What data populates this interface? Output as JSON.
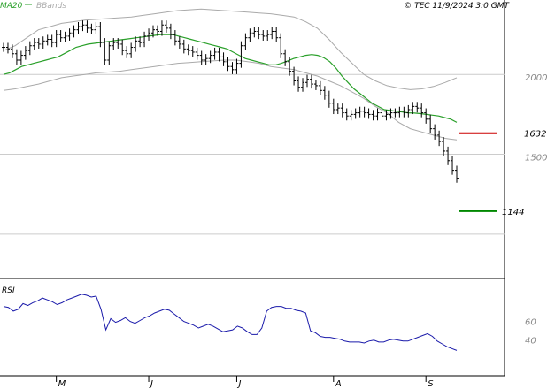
{
  "header": {
    "legend": [
      {
        "label": "MA20",
        "color": "#2aa02a"
      },
      {
        "label": "BBands",
        "color": "#aaaaaa"
      }
    ],
    "copyright": "© TEC 11/9/2024 3:0 GMT"
  },
  "colors": {
    "price": "#000000",
    "ma20": "#2aa02a",
    "bbands": "#aaaaaa",
    "rsi": "#1a1aaa",
    "resistance": "#cc0000",
    "support": "#008800",
    "grid": "#cccccc"
  },
  "chart_data": [
    {
      "type": "ohlc",
      "panel": "price",
      "ylim": [
        750,
        2400
      ],
      "yticks": [
        2000,
        1500
      ],
      "ytick_labels": [
        "2000",
        "1500"
      ],
      "levels": [
        {
          "name": "resistance",
          "value": 1632,
          "label": "1632"
        },
        {
          "name": "support",
          "value": 1144,
          "label": "1144"
        }
      ],
      "x_month_labels": [
        {
          "label": "M",
          "index": 12
        },
        {
          "label": "J",
          "index": 33
        },
        {
          "label": "J",
          "index": 53
        },
        {
          "label": "A",
          "index": 75
        },
        {
          "label": "S",
          "index": 96
        }
      ],
      "close": [
        2170,
        2160,
        2130,
        2090,
        2120,
        2150,
        2180,
        2200,
        2190,
        2210,
        2220,
        2200,
        2250,
        2230,
        2240,
        2260,
        2280,
        2300,
        2310,
        2290,
        2280,
        2300,
        2200,
        2090,
        2180,
        2200,
        2190,
        2150,
        2130,
        2170,
        2210,
        2200,
        2240,
        2260,
        2280,
        2270,
        2310,
        2290,
        2250,
        2210,
        2190,
        2160,
        2150,
        2140,
        2120,
        2090,
        2100,
        2120,
        2140,
        2110,
        2080,
        2050,
        2030,
        2070,
        2180,
        2230,
        2260,
        2270,
        2250,
        2240,
        2250,
        2270,
        2230,
        2130,
        2080,
        2020,
        1960,
        1920,
        1950,
        1970,
        1940,
        1930,
        1900,
        1870,
        1820,
        1780,
        1790,
        1760,
        1740,
        1750,
        1760,
        1770,
        1760,
        1750,
        1740,
        1760,
        1740,
        1750,
        1760,
        1760,
        1770,
        1760,
        1780,
        1800,
        1790,
        1760,
        1720,
        1660,
        1620,
        1580,
        1520,
        1460,
        1400,
        1350
      ]
    },
    {
      "type": "line",
      "panel": "price",
      "name": "MA20",
      "values": [
        2000,
        2010,
        2030,
        2050,
        2060,
        2070,
        2080,
        2090,
        2100,
        2110,
        2130,
        2150,
        2170,
        2180,
        2190,
        2195,
        2200,
        2205,
        2210,
        2215,
        2220,
        2225,
        2230,
        2235,
        2240,
        2245,
        2250,
        2250,
        2250,
        2240,
        2230,
        2220,
        2210,
        2200,
        2190,
        2180,
        2170,
        2160,
        2140,
        2120,
        2100,
        2090,
        2080,
        2070,
        2060,
        2060,
        2070,
        2085,
        2100,
        2110,
        2120,
        2125,
        2120,
        2105,
        2080,
        2040,
        1990,
        1950,
        1910,
        1880,
        1850,
        1820,
        1800,
        1780,
        1775,
        1770,
        1765,
        1760,
        1758,
        1755,
        1750,
        1745,
        1740,
        1730,
        1720,
        1700
      ]
    },
    {
      "type": "band",
      "panel": "price",
      "name": "BBands",
      "upper": [
        2150,
        2180,
        2230,
        2280,
        2300,
        2320,
        2330,
        2340,
        2345,
        2350,
        2355,
        2360,
        2370,
        2380,
        2390,
        2400,
        2405,
        2410,
        2405,
        2400,
        2395,
        2390,
        2385,
        2380,
        2370,
        2360,
        2330,
        2290,
        2220,
        2140,
        2070,
        2000,
        1960,
        1930,
        1915,
        1905,
        1910,
        1925,
        1950,
        1980
      ],
      "lower": [
        1900,
        1910,
        1925,
        1940,
        1960,
        1980,
        1990,
        2000,
        2010,
        2015,
        2020,
        2030,
        2040,
        2050,
        2060,
        2070,
        2075,
        2080,
        2085,
        2090,
        2090,
        2080,
        2070,
        2050,
        2040,
        2030,
        2010,
        1990,
        1960,
        1930,
        1890,
        1850,
        1800,
        1760,
        1700,
        1660,
        1640,
        1620,
        1600,
        1590
      ]
    },
    {
      "type": "line",
      "panel": "rsi",
      "name": "RSI",
      "ylim": [
        0,
        100
      ],
      "yticks": [
        60,
        40
      ],
      "ytick_labels": [
        "60",
        "40"
      ],
      "values": [
        73,
        72,
        68,
        70,
        76,
        74,
        77,
        79,
        82,
        80,
        78,
        75,
        77,
        80,
        82,
        84,
        86,
        85,
        83,
        84,
        70,
        48,
        60,
        56,
        58,
        61,
        57,
        55,
        58,
        61,
        63,
        66,
        68,
        70,
        69,
        65,
        61,
        57,
        55,
        53,
        50,
        52,
        54,
        52,
        49,
        46,
        47,
        48,
        52,
        50,
        46,
        43,
        43,
        50,
        68,
        72,
        73,
        73,
        71,
        71,
        69,
        68,
        66,
        47,
        45,
        41,
        40,
        40,
        39,
        38,
        36,
        35,
        35,
        35,
        34,
        36,
        37,
        35,
        35,
        37,
        38,
        37,
        36,
        36,
        38,
        40,
        42,
        44,
        41,
        36,
        33,
        30,
        28,
        26
      ]
    }
  ]
}
